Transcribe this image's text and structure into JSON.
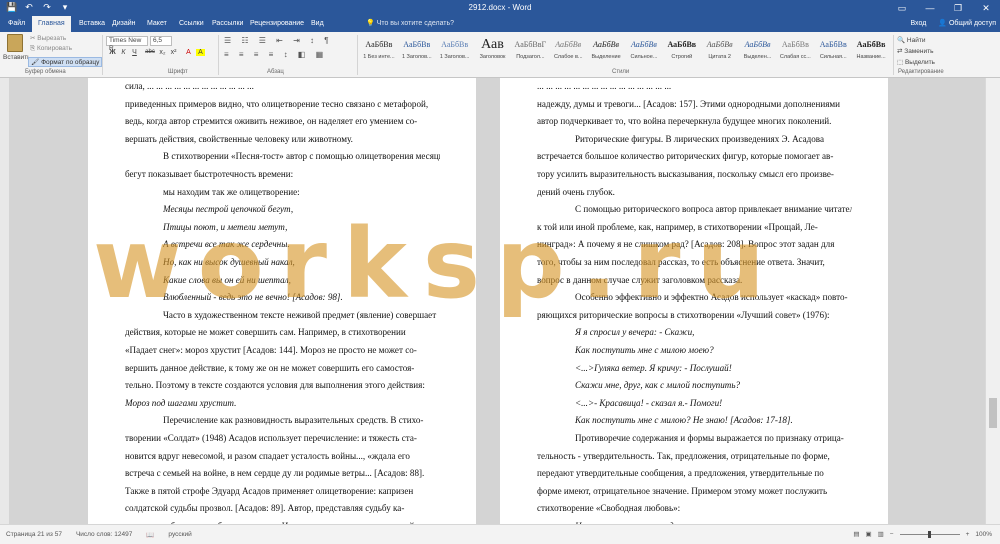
{
  "window": {
    "title": "2912.docx - Word",
    "qat": {
      "save_icon": "💾",
      "undo_icon": "↶",
      "redo_icon": "↷",
      "customize_icon": "▾"
    },
    "controls": {
      "ribbon_display": "▭",
      "minimize": "—",
      "restore": "❐",
      "close": "✕"
    }
  },
  "tabs": [
    "Файл",
    "Главная",
    "Вставка",
    "Дизайн",
    "Макет",
    "Ссылки",
    "Рассылки",
    "Рецензирование",
    "Вид"
  ],
  "active_tab": "Главная",
  "tell_me": "Что вы хотите сделать?",
  "account": {
    "signin": "Вход",
    "share": "Общий доступ"
  },
  "clipboard": {
    "paste": "Вставить",
    "cut": "Вырезать",
    "copy": "Копировать",
    "format_painter": "Формат по образцу",
    "label": "Буфер обмена"
  },
  "font": {
    "name": "Times New R",
    "size": "6,5",
    "label": "Шрифт",
    "buttons": [
      "Ж",
      "К",
      "Ч",
      "abc",
      "x₂",
      "x²",
      "A",
      "A"
    ]
  },
  "paragraph": {
    "label": "Абзац"
  },
  "styles": {
    "label": "Стили",
    "items": [
      {
        "preview": "АаБбВв",
        "name": "1 Без инте..."
      },
      {
        "preview": "АаБбВв",
        "name": "1 Заголов..."
      },
      {
        "preview": "АаБбВв",
        "name": "1 Заголов..."
      },
      {
        "preview": "Аав",
        "name": "Заголовок"
      },
      {
        "preview": "АаБбВвГ",
        "name": "Подзагол..."
      },
      {
        "preview": "АаБбВв",
        "name": "Слабое в..."
      },
      {
        "preview": "АаБбВв",
        "name": "Выделение"
      },
      {
        "preview": "АаБбВв",
        "name": "Сильное..."
      },
      {
        "preview": "АаБбВв",
        "name": "Строгий"
      },
      {
        "preview": "АаБбВв",
        "name": "Цитата 2"
      },
      {
        "preview": "АаБбВв",
        "name": "Выделен..."
      },
      {
        "preview": "АаБбВв",
        "name": "Слабая сс..."
      },
      {
        "preview": "АаБбВв",
        "name": "Сильная..."
      },
      {
        "preview": "АаБбВв",
        "name": "Название..."
      }
    ]
  },
  "editing": {
    "find": "Найти",
    "replace": "Заменить",
    "select": "Выделить",
    "label": "Редактирование"
  },
  "page1_lines": [
    {
      "t": "сила, ... ... ... ... ... ... ... ... ... ... ... ...",
      "cls": "justify"
    },
    {
      "t": "приведенных примеров видно, что олицетворение тесно связано с метафорой,",
      "cls": "justify"
    },
    {
      "t": "ведь, когда автор стремится оживить неживое, он наделяет его умением со-",
      "cls": "justify"
    },
    {
      "t": "вершать действия, свойственные человеку или животному.",
      "cls": "justify"
    },
    {
      "t": "В стихотворении «Песня-тост» автор с помощью олицетворения месяцы",
      "cls": "indent"
    },
    {
      "t": "бегут показывает быстротечность времени:",
      "cls": "justify"
    },
    {
      "t": "мы находим так же олицетворение:",
      "cls": "indent"
    },
    {
      "t": "Месяцы пестрой цепочкой бегут,",
      "cls": "indent-it"
    },
    {
      "t": "Птицы поют, и метели метут,",
      "cls": "indent-it"
    },
    {
      "t": "А встречи все так же сердечны.",
      "cls": "indent-it"
    },
    {
      "t": "Но, как ни высок душевный накал,",
      "cls": "indent-it"
    },
    {
      "t": "Какие слова вы он ей ни шептал,",
      "cls": "indent-it"
    },
    {
      "t": "Влюбленный - ведь это не вечно! [Асадов: 98].",
      "cls": "indent-it"
    },
    {
      "t": "Часто в художественном тексте неживой предмет (явление) совершает",
      "cls": "indent"
    },
    {
      "t": "действия, которые не может совершить сам. Например, в стихотворении",
      "cls": "justify"
    },
    {
      "t": "«Падает снег»: мороз хрустит [Асадов: 144]. Мороз не просто не может со-",
      "cls": "justify"
    },
    {
      "t": "вершить данное действие, к тому же он не может совершить его самостоя-",
      "cls": "justify"
    },
    {
      "t": "тельно. Поэтому в тексте создаются условия для выполнения этого действия:",
      "cls": "justify"
    },
    {
      "t": "Мороз под шагами хрустит.",
      "cls": "justify-it"
    },
    {
      "t": "Перечисление как разновидность выразительных средств. В стихо-",
      "cls": "indent"
    },
    {
      "t": "творении «Солдат» (1948) Асадов использует перечисление: и тяжесть ста-",
      "cls": "justify"
    },
    {
      "t": "новится вдруг невесомой, и разом спадает усталость войны..., «ждала его",
      "cls": "justify"
    },
    {
      "t": "встреча с семьей на войне, в нем сердце ду ли родимые ветры... [Асадов: 88].",
      "cls": "justify"
    },
    {
      "t": "Также в пятой строфе Эдуард Асадов применяет олицетворение: капризен",
      "cls": "justify"
    },
    {
      "t": "солдатской судьбы прозвол. [Асадов: 89]. Автор, представляя судьбу ка-",
      "cls": "justify"
    },
    {
      "t": "призным ребенком, как бы оживляет ее. И в двух последних строчках этой",
      "cls": "justify"
    },
    {
      "t": "строфы поэт употребляет антитезу: две тысячи верст прошагал он до хаты, в",
      "cls": "justify"
    }
  ],
  "page2_lines": [
    {
      "t": "... ... ... ... ... ... ... ... ... ... ... ... ... ... ...",
      "cls": "justify"
    },
    {
      "t": "надежду, думы и тревоги... [Асадов: 157]. Этими однородными дополнениями",
      "cls": "justify"
    },
    {
      "t": "автор подчеркивает то, что война перечеркнула будущее многих поколений.",
      "cls": "justify"
    },
    {
      "t": "Риторические фигуры. В лирических произведениях Э. Асадова",
      "cls": "indent"
    },
    {
      "t": "встречается большое количество риторических фигур, которые помогает ав-",
      "cls": "justify"
    },
    {
      "t": "тору усилить выразительность высказывания, поскольку смысл его произве-",
      "cls": "justify"
    },
    {
      "t": "дений очень глубок.",
      "cls": "justify"
    },
    {
      "t": "С помощью риторического вопроса автор привлекает внимание читателя",
      "cls": "indent"
    },
    {
      "t": "к той или иной проблеме, как, например, в стихотворении «Прощай, Ле-",
      "cls": "justify"
    },
    {
      "t": "нинград»: А почему я не слишком рад? [Асадов: 208]. Вопрос этот задан для",
      "cls": "justify"
    },
    {
      "t": "того, чтобы за ним последовал рассказ, то есть объяснение ответа. Значит,",
      "cls": "justify"
    },
    {
      "t": "вопрос в данном случае служит заголовком рассказа.",
      "cls": "justify"
    },
    {
      "t": "Особенно эффективно и эффектно Асадов использует «каскад» повто-",
      "cls": "indent"
    },
    {
      "t": "ряющихся риторические вопросы в стихотворении «Лучший совет» (1976):",
      "cls": "justify"
    },
    {
      "t": "Я я спросил у вечера: - Скажи,",
      "cls": "indent-it"
    },
    {
      "t": "Как поступить мне с милою моею?",
      "cls": "indent-it"
    },
    {
      "t": "<...>Гуляка ветер. Я кричу: - Послушай!",
      "cls": "indent-it"
    },
    {
      "t": "Скажи мне, друг, как с милой поступить?",
      "cls": "indent-it"
    },
    {
      "t": "<...>- Красавица! - сказал я.- Помоги!",
      "cls": "indent-it"
    },
    {
      "t": "Как поступить мне с милою? Не знаю! [Асадов: 17-18].",
      "cls": "indent-it"
    },
    {
      "t": "Противоречие содержания и формы выражается по признаку отрица-",
      "cls": "indent"
    },
    {
      "t": "тельность - утвердительность. Так, предложения, отрицательные по форме,",
      "cls": "justify"
    },
    {
      "t": "передают утвердительные сообщения, а предложения, утвердительные по",
      "cls": "justify"
    },
    {
      "t": "форме имеют, отрицательное значение. Примером этому может послужить",
      "cls": "justify"
    },
    {
      "t": "стихотворение «Свободная любовь»:",
      "cls": "justify"
    },
    {
      "t": "Неужто вам нравится, дорогая,",
      "cls": "indent-it"
    },
    {
      "t": "Вот так, по-копеечному порхая,",
      "cls": "indent-it"
    }
  ],
  "watermark": "worksp.ru",
  "statusbar": {
    "page": "Страница 21 из 57",
    "words": "Число слов: 12497",
    "lang": "русский",
    "zoom": "100%"
  }
}
